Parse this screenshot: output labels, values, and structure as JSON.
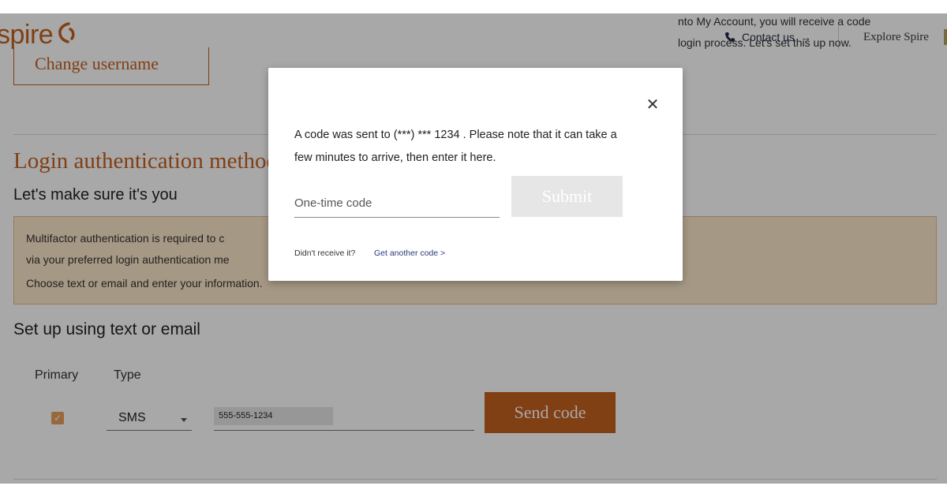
{
  "header": {
    "logo_text": "spire",
    "contact_label": "Contact us",
    "contact_arrow": "→",
    "explore_label": "Explore Spire"
  },
  "account": {
    "change_username_label": "Change username",
    "section_title": "Login authentication method",
    "section_subtitle": "Let's make sure it's you",
    "info_line1": "Multifactor authentication is required to c",
    "info_line1_right": "nto My Account, you will receive a code",
    "info_line2": "via your preferred login authentication me",
    "info_line2_right": "login process. Let's set this up now.",
    "info_line3": "Choose text or email and enter your information.",
    "setup_title": "Set up using text or email",
    "col_primary": "Primary",
    "col_type": "Type",
    "checkbox_mark": "✓",
    "type_value": "SMS",
    "phone_value": "555-555-1234",
    "send_code_label": "Send code"
  },
  "modal": {
    "close_glyph": "✕",
    "message_line1": "A code was sent to (***) *** 1234 . Please note that it can take a",
    "message_line2": "few minutes to arrive, then enter it here.",
    "code_placeholder": "One-time code",
    "code_value": "",
    "submit_label": "Submit",
    "didnt_receive": "Didn't receive it?",
    "get_another_code": "Get another code >"
  },
  "colors": {
    "brand": "#c4601f",
    "info_bg": "#fbe7c8",
    "link": "#2a3a7a"
  }
}
